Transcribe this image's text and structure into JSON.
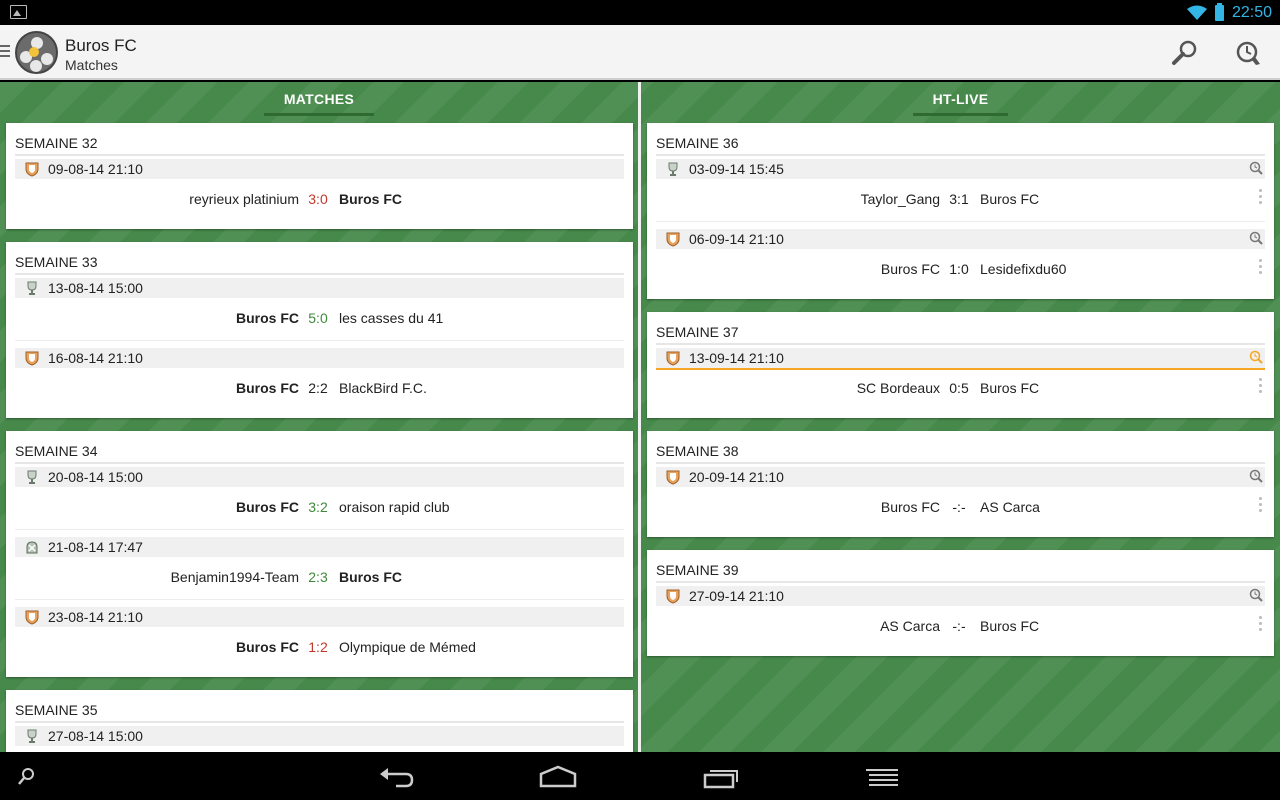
{
  "status_bar": {
    "time": "22:50",
    "icons": [
      "image-notification-icon",
      "wifi-icon",
      "battery-icon"
    ]
  },
  "action_bar": {
    "title": "Buros FC",
    "subtitle": "Matches",
    "actions": [
      "search-icon",
      "alarm-icon"
    ]
  },
  "colors": {
    "field_green": "#46894a",
    "win": "#3f8a3a",
    "loss": "#c0392b",
    "highlight": "#f5a623",
    "holo_blue": "#33b5e5"
  },
  "matches_column": {
    "tab_label": "MATCHES",
    "weeks": [
      {
        "title": "SEMAINE 32",
        "matches": [
          {
            "comp": "shield",
            "date": "09-08-14 21:10",
            "home": "reyrieux platinium",
            "score": "3:0",
            "away": "Buros FC",
            "home_bold": false,
            "away_bold": true,
            "result": "loss"
          }
        ]
      },
      {
        "title": "SEMAINE 33",
        "matches": [
          {
            "comp": "trophy",
            "date": "13-08-14 15:00",
            "home": "Buros FC",
            "score": "5:0",
            "away": "les casses du 41",
            "home_bold": true,
            "away_bold": false,
            "result": "win"
          },
          {
            "comp": "shield",
            "date": "16-08-14 21:10",
            "home": "Buros FC",
            "score": "2:2",
            "away": "BlackBird F.C.",
            "home_bold": true,
            "away_bold": false,
            "result": "draw"
          }
        ]
      },
      {
        "title": "SEMAINE 34",
        "matches": [
          {
            "comp": "trophy",
            "date": "20-08-14 15:00",
            "home": "Buros FC",
            "score": "3:2",
            "away": "oraison rapid club",
            "home_bold": true,
            "away_bold": false,
            "result": "win"
          },
          {
            "comp": "friendly",
            "date": "21-08-14 17:47",
            "home": "Benjamin1994-Team",
            "score": "2:3",
            "away": "Buros FC",
            "home_bold": false,
            "away_bold": true,
            "result": "win"
          },
          {
            "comp": "shield",
            "date": "23-08-14 21:10",
            "home": "Buros FC",
            "score": "1:2",
            "away": "Olympique de Mémed",
            "home_bold": true,
            "away_bold": false,
            "result": "loss"
          }
        ]
      },
      {
        "title": "SEMAINE 35",
        "matches": [
          {
            "comp": "trophy",
            "date": "27-08-14 15:00"
          }
        ]
      }
    ]
  },
  "htlive_column": {
    "tab_label": "HT-LIVE",
    "weeks": [
      {
        "title": "SEMAINE 36",
        "matches": [
          {
            "comp": "trophy",
            "date": "03-09-14 15:45",
            "home": "Taylor_Gang",
            "score": "3:1",
            "away": "Buros FC",
            "alarm": "off"
          },
          {
            "comp": "shield",
            "date": "06-09-14 21:10",
            "home": "Buros FC",
            "score": "1:0",
            "away": "Lesidefixdu60",
            "alarm": "off"
          }
        ]
      },
      {
        "title": "SEMAINE 37",
        "matches": [
          {
            "comp": "shield",
            "date": "13-09-14 21:10",
            "home": "SC Bordeaux",
            "score": "0:5",
            "away": "Buros FC",
            "alarm": "on",
            "selected": true
          }
        ]
      },
      {
        "title": "SEMAINE 38",
        "matches": [
          {
            "comp": "shield",
            "date": "20-09-14 21:10",
            "home": "Buros FC",
            "score": "-:-",
            "away": "AS Carca",
            "alarm": "off"
          }
        ]
      },
      {
        "title": "SEMAINE 39",
        "matches": [
          {
            "comp": "shield",
            "date": "27-09-14 21:10",
            "home": "AS Carca",
            "score": "-:-",
            "away": "Buros FC",
            "alarm": "off"
          }
        ]
      }
    ]
  },
  "nav_bar": {
    "buttons": [
      "search-icon",
      "back-icon",
      "home-icon",
      "recent-apps-icon",
      "menu-icon"
    ]
  }
}
